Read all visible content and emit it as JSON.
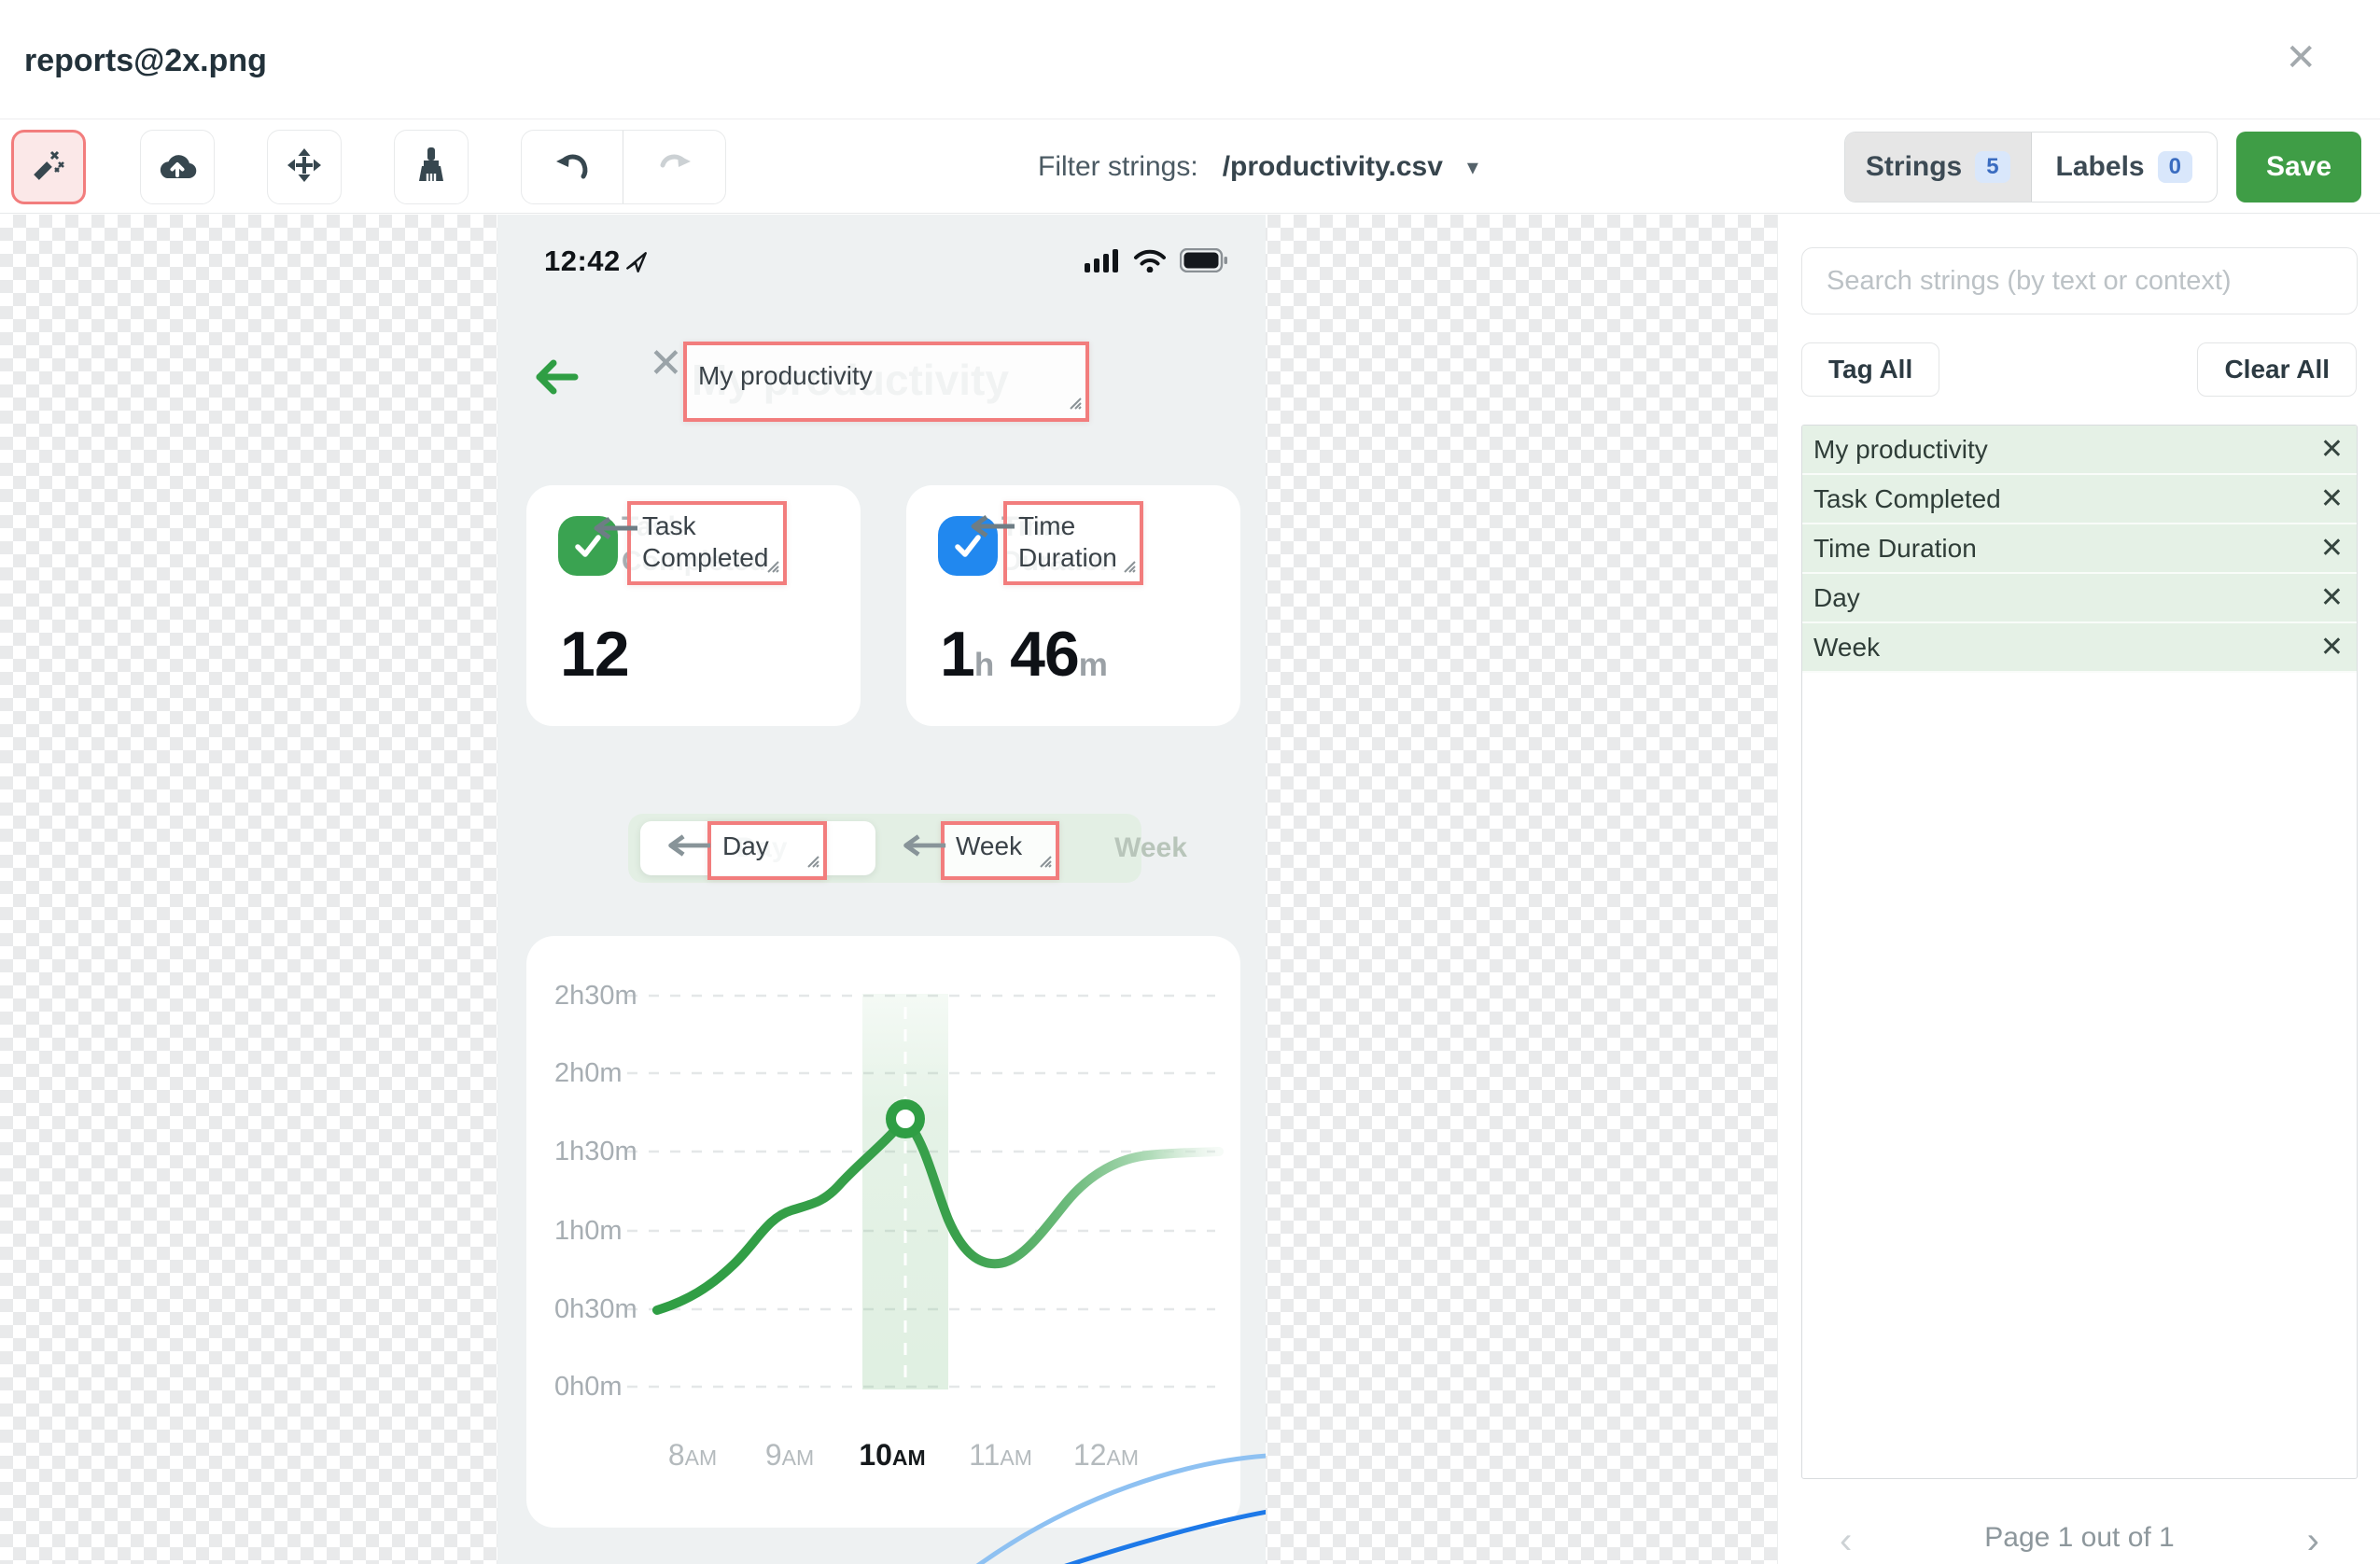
{
  "window": {
    "title": "reports@2x.png"
  },
  "glyphs": {
    "close": "✕",
    "caret": "▾",
    "chev_left": "‹",
    "chev_right": "›",
    "remove": "✕"
  },
  "toolbar": {
    "filter_label": "Filter strings:",
    "filter_value": "/productivity.csv",
    "tabs": {
      "strings_label": "Strings",
      "strings_count": "5",
      "labels_label": "Labels",
      "labels_count": "0"
    },
    "save_label": "Save"
  },
  "phone": {
    "status_time": "12:42",
    "nav_title": "My productivity",
    "cards": [
      {
        "title": "Task Completed",
        "value": "12"
      },
      {
        "title": "Time Duration",
        "value_h": "1",
        "unit_h": "h",
        "value_m": "46",
        "unit_m": "m"
      }
    ],
    "toggle": {
      "day": "Day",
      "week": "Week"
    }
  },
  "annotations": {
    "title": "My productivity",
    "task": "Task Completed",
    "time": "Time Duration",
    "day": "Day",
    "week": "Week"
  },
  "chart_data": {
    "type": "line",
    "title": "",
    "x": [
      "8AM",
      "9AM",
      "10AM",
      "11AM",
      "12AM"
    ],
    "x_parts": [
      {
        "n": "8",
        "s": "AM"
      },
      {
        "n": "9",
        "s": "AM"
      },
      {
        "n": "10",
        "s": "AM"
      },
      {
        "n": "11",
        "s": "AM"
      },
      {
        "n": "12",
        "s": "AM"
      }
    ],
    "series": [
      {
        "name": "Time Duration",
        "values_minutes": [
          30,
          68,
          106,
          50,
          90
        ]
      }
    ],
    "y_ticks": [
      "2h30m",
      "2h0m",
      "1h30m",
      "1h0m",
      "0h30m",
      "0h0m"
    ],
    "ylim_minutes": [
      0,
      150
    ],
    "grid": "dashed-horizontal",
    "highlight_x": "10AM",
    "marker": {
      "x": "10AM",
      "value": "1h46m"
    },
    "line_color": "#2f9e44",
    "highlight_band_color": "#e7f3e8"
  },
  "sidebar": {
    "search_placeholder": "Search strings (by text or context)",
    "tag_all": "Tag All",
    "clear_all": "Clear All",
    "strings": [
      {
        "label": "My productivity"
      },
      {
        "label": "Task Completed"
      },
      {
        "label": "Time Duration"
      },
      {
        "label": "Day"
      },
      {
        "label": "Week"
      }
    ],
    "pagination": "Page 1 out of 1"
  }
}
